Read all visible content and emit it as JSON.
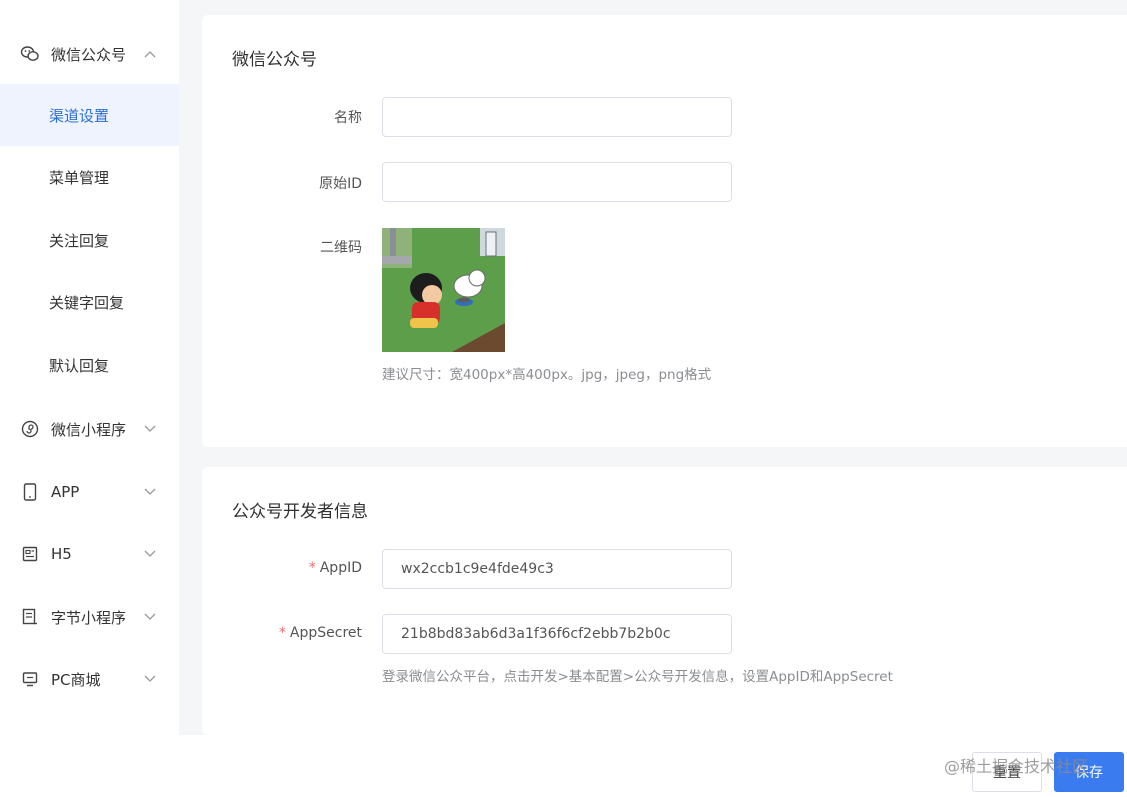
{
  "sidebar": {
    "groups": [
      {
        "label": "微信公众号",
        "icon": "wechat-icon",
        "expanded": true
      },
      {
        "label": "微信小程序",
        "icon": "miniprogram-icon",
        "expanded": false
      },
      {
        "label": "APP",
        "icon": "phone-icon",
        "expanded": false
      },
      {
        "label": "H5",
        "icon": "h5-icon",
        "expanded": false
      },
      {
        "label": "字节小程序",
        "icon": "bytedance-icon",
        "expanded": false
      },
      {
        "label": "PC商城",
        "icon": "monitor-icon",
        "expanded": false
      }
    ],
    "sub_items": [
      {
        "label": "渠道设置",
        "active": true
      },
      {
        "label": "菜单管理",
        "active": false
      },
      {
        "label": "关注回复",
        "active": false
      },
      {
        "label": "关键字回复",
        "active": false
      },
      {
        "label": "默认回复",
        "active": false
      }
    ]
  },
  "section1": {
    "title": "微信公众号",
    "name_label": "名称",
    "name_value": "",
    "original_id_label": "原始ID",
    "original_id_value": "",
    "qrcode_label": "二维码",
    "qrcode_hint": "建议尺寸：宽400px*高400px。jpg，jpeg，png格式"
  },
  "section2": {
    "title": "公众号开发者信息",
    "appid_label": "AppID",
    "appid_value": "wx2ccb1c9e4fde49c3",
    "appsecret_label": "AppSecret",
    "appsecret_value": "21b8bd83ab6d3a1f36f6cf2ebb7b2b0c",
    "hint": "登录微信公众平台，点击开发>基本配置>公众号开发信息，设置AppID和AppSecret",
    "required_mark": "*"
  },
  "footer": {
    "reset_label": "重置",
    "save_label": "保存",
    "watermark": "@稀土掘金技术社区"
  },
  "colors": {
    "accent": "#3a7bf0",
    "active_bg": "#eef3fd",
    "active_text": "#2c6fd6",
    "required": "#f56c6c"
  }
}
